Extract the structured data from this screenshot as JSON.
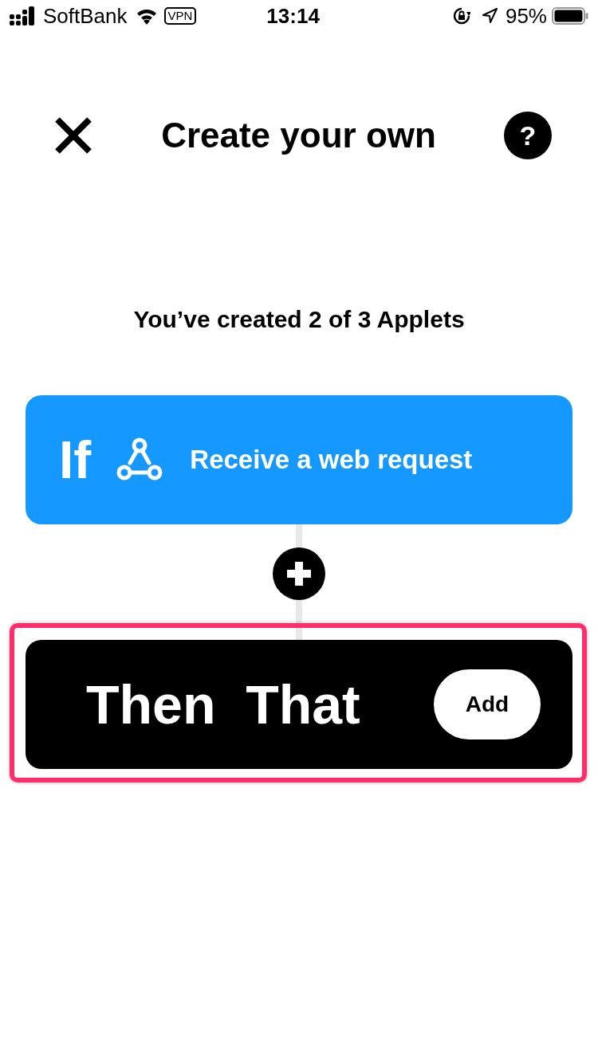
{
  "status_bar": {
    "carrier": "SoftBank",
    "vpn": "VPN",
    "time": "13:14",
    "battery": "95%"
  },
  "header": {
    "title": "Create your own",
    "help": "?"
  },
  "subtitle": "You’ve created 2 of 3 Applets",
  "trigger": {
    "keyword": "If",
    "label": "Receive a web request"
  },
  "action": {
    "label": "Then  That",
    "button": "Add",
    "highlighted": true
  }
}
